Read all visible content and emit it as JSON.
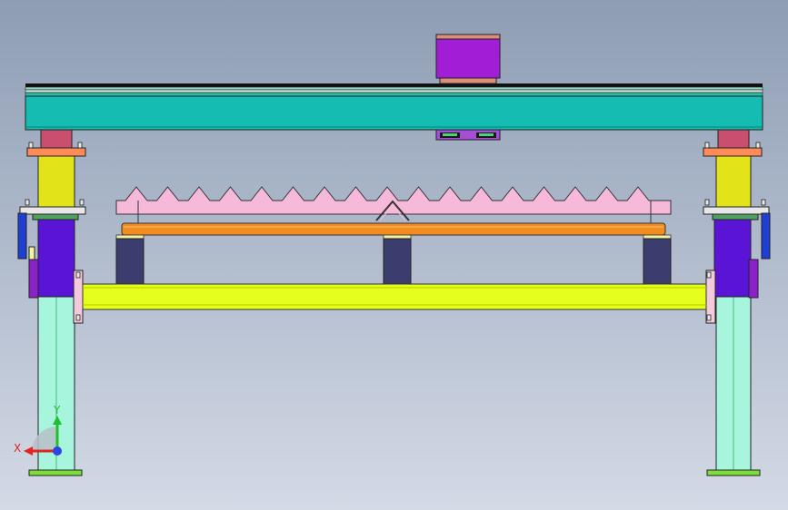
{
  "view": {
    "background_top": "#8e9db4",
    "background_bottom": "#d4dae6"
  },
  "axes": {
    "x_label": "X",
    "y_label": "Y",
    "x_color": "#e0251f",
    "y_color": "#1ec12b",
    "z_color": "#2a45e0"
  },
  "colors": {
    "top_beam": "#14bcb2",
    "top_block": "#a11ed6",
    "top_block_cap": "#d98f7a",
    "column_lower": "#a8f5de",
    "column_upper": "#e3e31a",
    "column_cap": "#c8506e",
    "actuator_body": "#5a14d6",
    "handle": "#1d3fd4",
    "cross_beam": "#e6ff1a",
    "toothed_plate": "#f7b9d9",
    "carrier_bar": "#f28c1f",
    "support_block": "#3b3d6e",
    "base_plate": "#7ddf3a",
    "flange": "#ff8c58"
  }
}
